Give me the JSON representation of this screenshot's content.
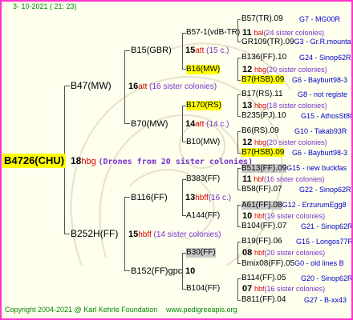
{
  "header": {
    "date": "3- 10-2021 ( 21: 23)"
  },
  "root": {
    "id": "B4726(CHU)",
    "mark": "18",
    "breed": "hbg",
    "note": "(Drones from 20 sister colonies)"
  },
  "gen1": {
    "a": {
      "id": "B47(MW)",
      "mark": "16",
      "breed": "att",
      "note": "(16 sister colonies)"
    },
    "b": {
      "id": "B252H(FF)",
      "mark": "15",
      "breed": "hbff",
      "note": "(14 sister colonies)"
    }
  },
  "gen2": {
    "a": {
      "id": "B15(GBR)",
      "mark": "15",
      "breed": "att",
      "note": "(15 c.)"
    },
    "b": {
      "id": "B70(MW)",
      "mark": "14",
      "breed": "att",
      "note": "(14 c.)"
    },
    "c": {
      "id": "B116(FF)",
      "mark": "13",
      "breed": "hbff",
      "note": "(16 c.)"
    },
    "d": {
      "id": "B152(FF)gpc",
      "mark": "10",
      "breed": "",
      "note": ""
    }
  },
  "gen3": {
    "a": {
      "id": "B57-1(vdB-TR)",
      "mark": "11",
      "breed": "bal",
      "note": "(24 sister colonies)"
    },
    "b": {
      "id": "B16(MW)",
      "mark": "12",
      "breed": "hbg",
      "note": "(20 sister colonies)"
    },
    "c": {
      "id": "B170(RS)",
      "mark": "13",
      "breed": "hbg",
      "note": "(18 sister colonies)"
    },
    "d": {
      "id": "B10(MW)",
      "mark": "12",
      "breed": "hbg",
      "note": "(20 sister colonies)"
    },
    "e": {
      "id": "B383(FF)",
      "mark": "11",
      "breed": "hbf",
      "note": "(16 sister colonies)"
    },
    "f": {
      "id": "A144(FF)",
      "mark": "10",
      "breed": "hbf",
      "note": "(19 sister colonies)"
    },
    "g": {
      "id": "B30(FF)",
      "mark": "08",
      "breed": "hbf",
      "note": "(20 sister colonies)"
    },
    "h": {
      "id": "B104(FF)",
      "mark": "07",
      "breed": "hbf",
      "note": "(16 sister colonies)"
    }
  },
  "gen4": [
    {
      "id": "B57(TR).09",
      "info": "G7 - MG00R"
    },
    {
      "id": "GR109(TR).09",
      "info": "G3 - Gr.R.mounta"
    },
    {
      "id": "B136(FF).10",
      "info": "G24 - Sinop62R"
    },
    {
      "id": "B7(HSB).09",
      "info": "G6 - Bayburt98-3"
    },
    {
      "id": "B17(RS).11",
      "info": "G8 - not registe"
    },
    {
      "id": "B235(PJ).10",
      "info": "G15 - AthosSt80R"
    },
    {
      "id": "B6(RS).09",
      "info": "G10 - Takab93R"
    },
    {
      "id": "B7(HSB).09",
      "info": "G6 - Bayburt98-3"
    },
    {
      "id": "B513(FF).09",
      "info": "G15 - new buckfas"
    },
    {
      "id": "B58(FF).07",
      "info": "G22 - Sinop62R"
    },
    {
      "id": "A61(FF).08",
      "info": "G12 - ErzurumEgg8"
    },
    {
      "id": "B104(FF).07",
      "info": "G21 - Sinop62R"
    },
    {
      "id": "B19(FF).06",
      "info": "G15 - Longos77R"
    },
    {
      "id": "Bmix08(FF).05",
      "info": "G0 - old lines B"
    },
    {
      "id": "B114(FF).05",
      "info": "G20 - Sinop62R"
    },
    {
      "id": "B811(FF).04",
      "info": "G27 - B-xx43"
    }
  ],
  "footer": {
    "copyright": "Copyright 2004-2021 @ Karl Kehrle Foundation",
    "url": "www.pedigreeapis.org"
  },
  "colors": {
    "border": "#ff33cc",
    "background": "#ffffee",
    "highlight_yellow": "#ffff00",
    "highlight_grey": "#c8c8c8",
    "breed_red": "#dd0000",
    "note_purple": "#7733cc",
    "info_blue": "#0000cc",
    "footer_green": "#008800"
  }
}
